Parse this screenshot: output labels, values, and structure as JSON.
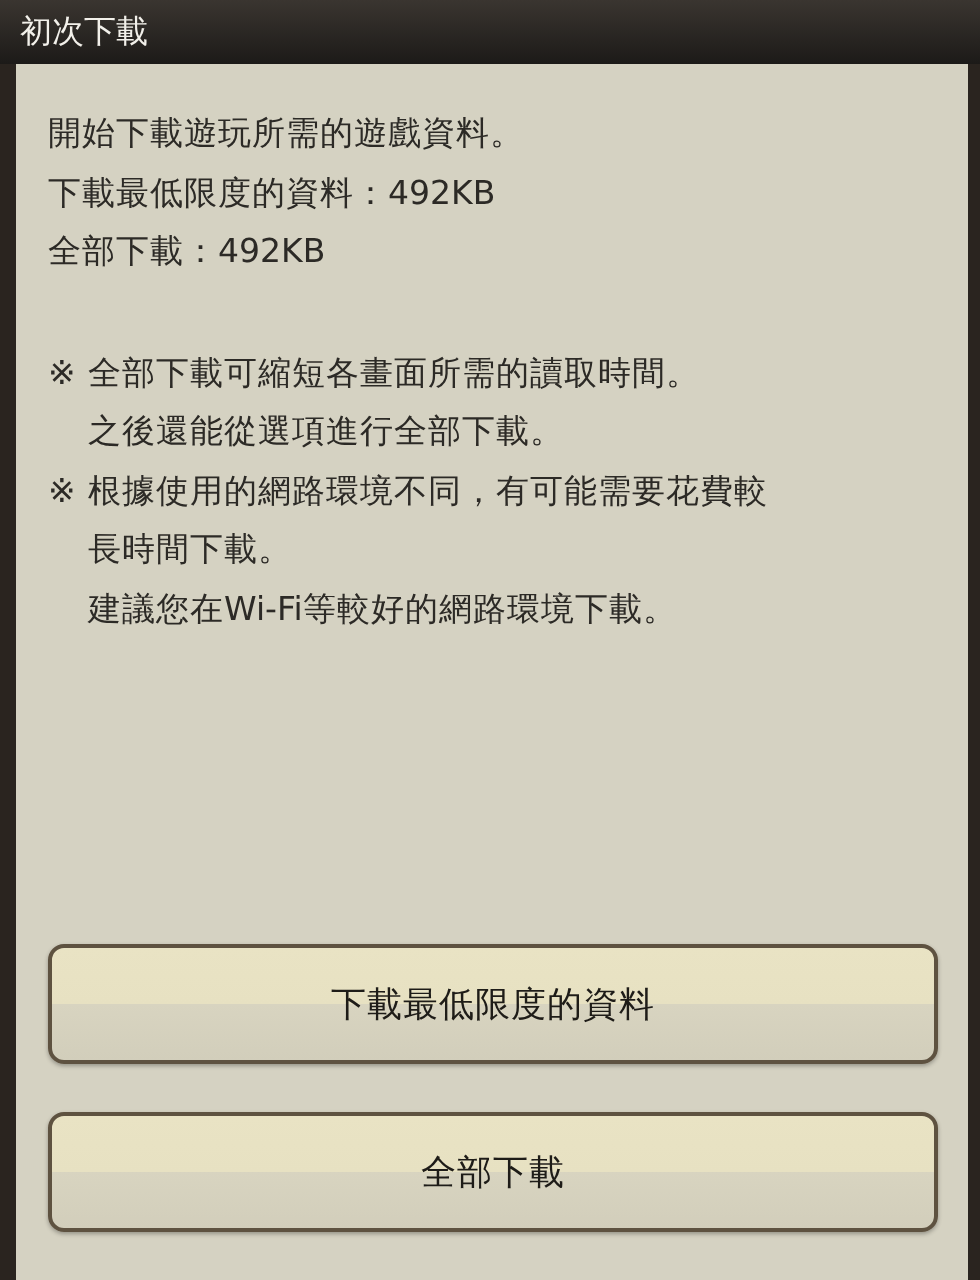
{
  "dialog": {
    "title": "初次下載",
    "intro": [
      "開始下載遊玩所需的遊戲資料。",
      "下載最低限度的資料：492KB",
      "全部下載：492KB"
    ],
    "notes": [
      {
        "mark": "※",
        "lines": [
          "全部下載可縮短各畫面所需的讀取時間。",
          "之後還能從選項進行全部下載。"
        ]
      },
      {
        "mark": "※",
        "lines": [
          "根據使用的網路環境不同，有可能需要花費較",
          "長時間下載。",
          "建議您在Wi-Fi等較好的網路環境下載。"
        ]
      }
    ],
    "buttons": [
      "下載最低限度的資料",
      "全部下載"
    ]
  }
}
